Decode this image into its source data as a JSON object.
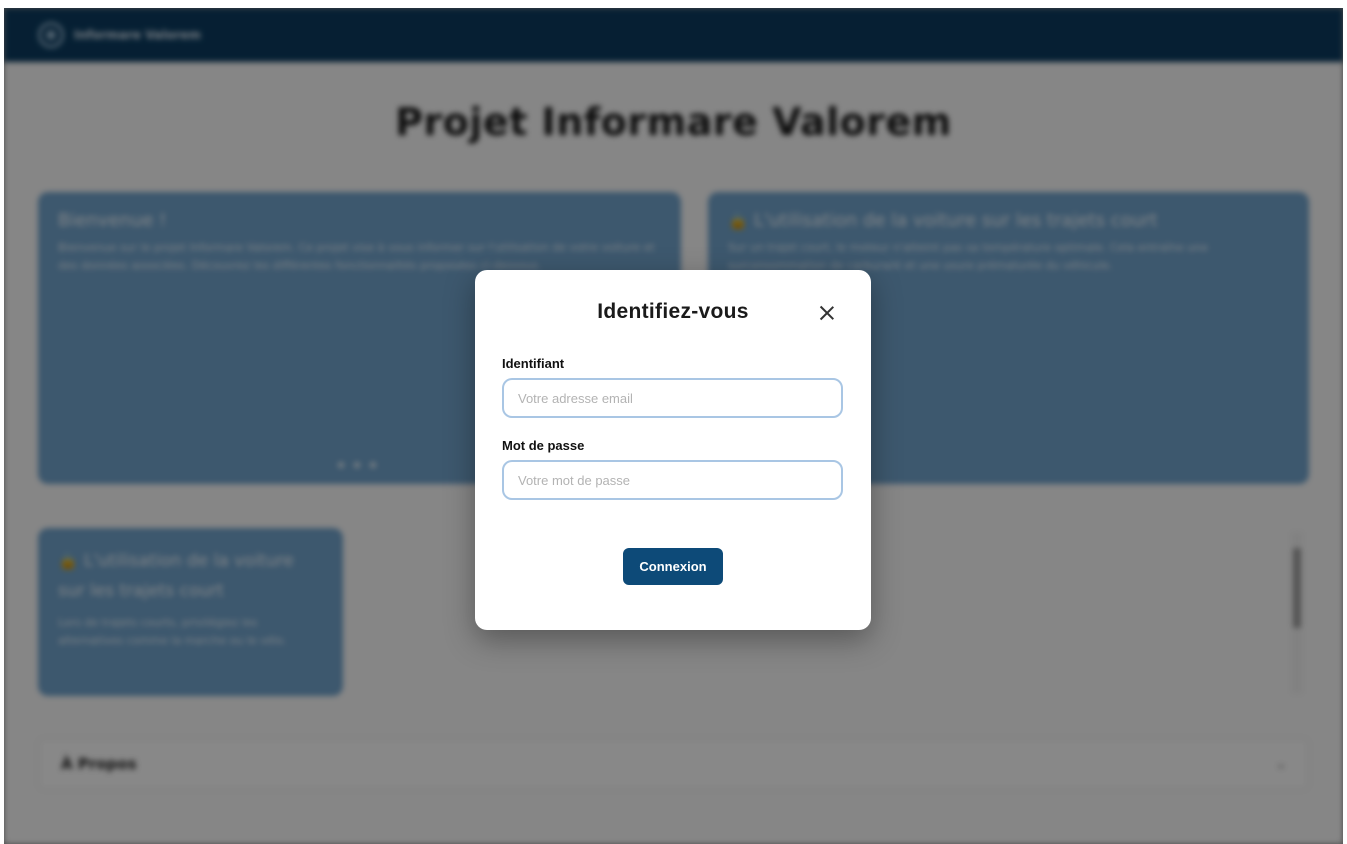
{
  "app": {
    "brand": "Informare Valorem",
    "page_title": "Projet Informare Valorem"
  },
  "cards": [
    {
      "title": "Bienvenue !",
      "text": "Bienvenue sur le projet Informare Valorem. Ce projet vise à vous informer sur l'utilisation de votre voiture et des données associées. Découvrez les différentes fonctionnalités proposées ci-dessous."
    },
    {
      "title": "L'utilisation de la voiture sur les trajets court",
      "text": "Sur un trajet court, le moteur n'atteint pas sa température optimale. Cela entraîne une surconsommation de carburant et une usure prématurée du véhicule."
    },
    {
      "title": "L'utilisation de la voiture sur les trajets court",
      "text": "Lors de trajets courts, privilégiez les alternatives comme la marche ou le vélo."
    }
  ],
  "accordion": {
    "label": "À Propos"
  },
  "modal": {
    "title": "Identifiez-vous",
    "login_label": "Identifiant",
    "login_placeholder": "Votre adresse email",
    "password_label": "Mot de passe",
    "password_placeholder": "Votre mot de passe",
    "submit_label": "Connexion"
  },
  "colors": {
    "navbar": "#0b3a5e",
    "card": "#6fa0c8",
    "primary_button": "#0d4a78",
    "input_border": "#a9c6e4"
  },
  "icons": {
    "close": "close-icon",
    "lock": "lock-icon",
    "logo": "logo-icon",
    "chevron": "chevron-down-icon"
  }
}
